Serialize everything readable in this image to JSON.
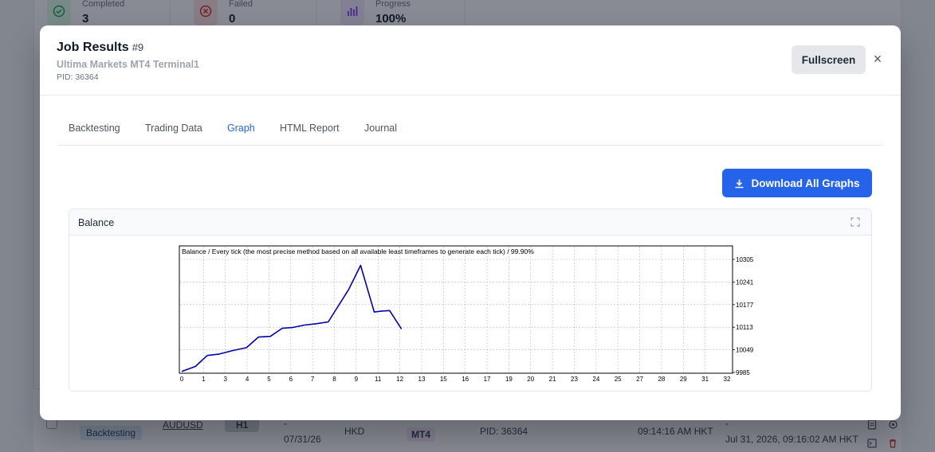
{
  "background": {
    "stats": [
      {
        "label": "Completed",
        "value": "3",
        "icon": "check-circle-icon"
      },
      {
        "label": "Failed",
        "value": "0",
        "icon": "x-circle-icon"
      },
      {
        "label": "Progress",
        "value": "100%",
        "icon": "bar-chart-icon"
      }
    ],
    "row": {
      "type_badge": "Backtesting",
      "symbol": "AUDUSD",
      "timeframe": "H1",
      "date_dash": "-",
      "date": "07/31/26",
      "currency": "HKD",
      "platform": "MT4",
      "terminal_pid": "PID: 36364",
      "time": "09:14:16 AM HKT",
      "created_dash": "-",
      "created": "Jul 31, 2026, 09:16:02 AM HKT"
    }
  },
  "modal": {
    "title": "Job Results",
    "job_number": "#9",
    "terminal_name": "Ultima Markets MT4 Terminal1",
    "pid": "PID: 36364",
    "fullscreen_label": "Fullscreen",
    "close_symbol": "×",
    "tabs": [
      {
        "label": "Backtesting",
        "active": false
      },
      {
        "label": "Trading Data",
        "active": false
      },
      {
        "label": "Graph",
        "active": true
      },
      {
        "label": "HTML Report",
        "active": false
      },
      {
        "label": "Journal",
        "active": false
      }
    ],
    "download_label": "Download All Graphs",
    "panel_title": "Balance",
    "colors": {
      "accent": "#2563eb",
      "line": "#0000b0"
    }
  },
  "chart_data": {
    "type": "line",
    "title": "Balance / Every tick (the most precise method based on all available least timeframes to generate each tick) / 99.90%",
    "x_tick_labels": [
      "0",
      "1",
      "3",
      "4",
      "5",
      "6",
      "7",
      "8",
      "9",
      "11",
      "12",
      "13",
      "15",
      "16",
      "17",
      "19",
      "20",
      "21",
      "23",
      "24",
      "25",
      "27",
      "28",
      "29",
      "31",
      "32"
    ],
    "y_tick_labels": [
      "10305",
      "10241",
      "10177",
      "10113",
      "10049",
      "9985"
    ],
    "ylim": [
      9985,
      10305
    ],
    "grid": true,
    "series": [
      {
        "name": "",
        "color": "#0000b0",
        "x": [
          0,
          0.8,
          1.5,
          2.2,
          3.0,
          3.8,
          4.5,
          5.2,
          5.9,
          6.5,
          7.2,
          7.9,
          8.6,
          9.8,
          10.5,
          11.3,
          11.8,
          12.2,
          12.9
        ],
        "y": [
          9988,
          10002,
          10033,
          10037,
          10047,
          10055,
          10085,
          10087,
          10110,
          10112,
          10119,
          10123,
          10128,
          10220,
          10288,
          10156,
          10159,
          10160,
          10108
        ]
      }
    ]
  }
}
